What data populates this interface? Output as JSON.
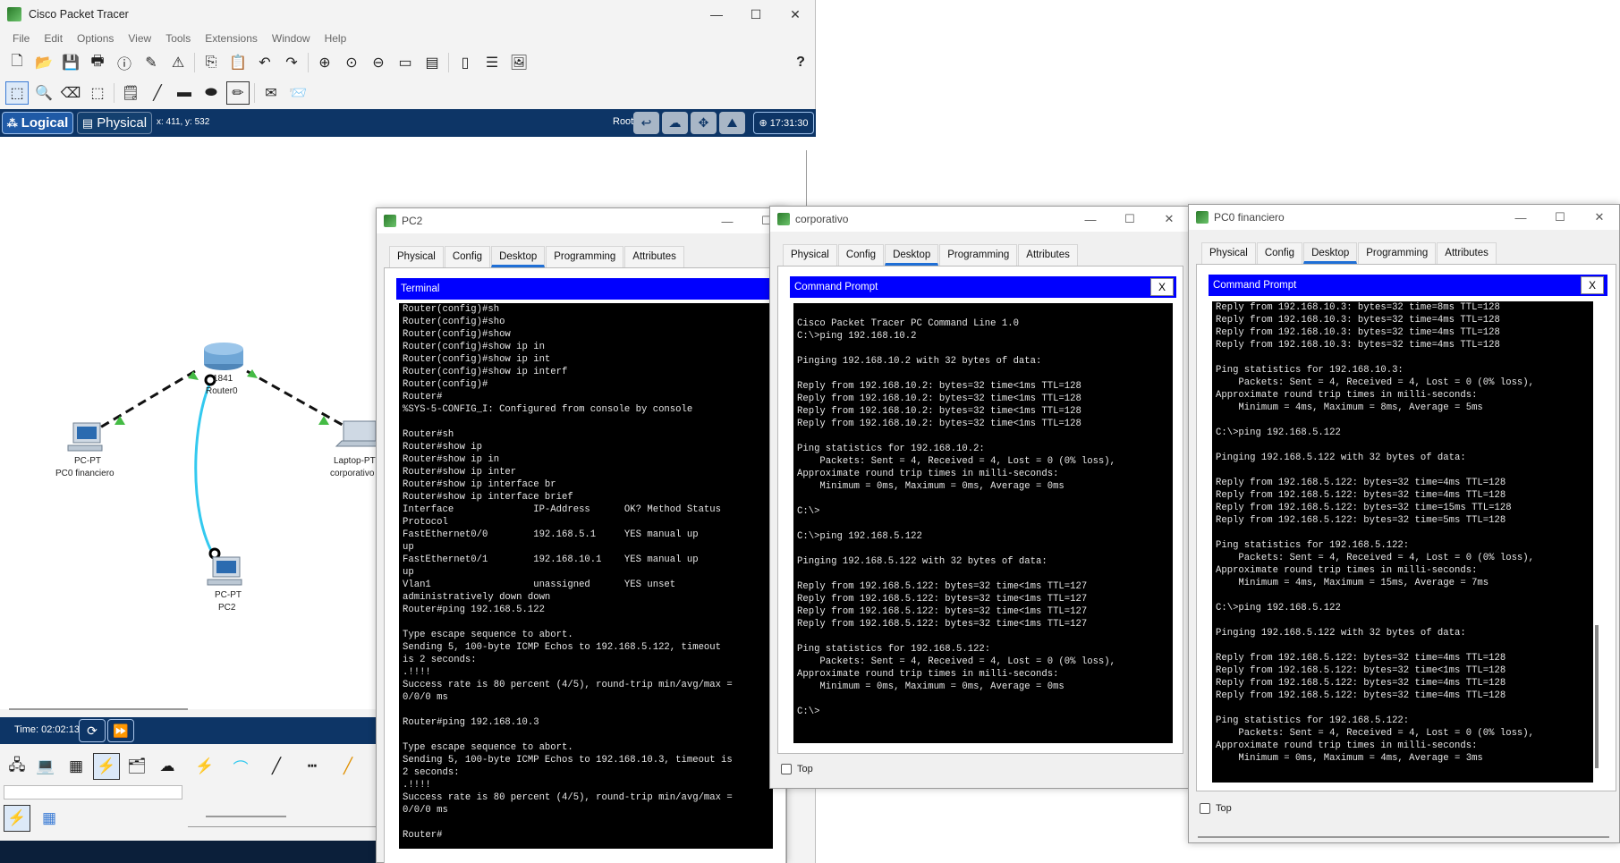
{
  "main": {
    "title": "Cisco Packet Tracer",
    "menu": [
      "File",
      "Edit",
      "Options",
      "View",
      "Tools",
      "Extensions",
      "Window",
      "Help"
    ],
    "toolbar_help": "?",
    "mode_logical": "Logical",
    "mode_physical": "Physical",
    "coords": "x: 411, y: 532",
    "root": "Root",
    "clock": "17:31:30",
    "time": "Time: 02:02:13"
  },
  "topology": {
    "router": {
      "model": "1841",
      "name": "Router0"
    },
    "pc0": {
      "type": "PC-PT",
      "name": "PC0 financiero"
    },
    "pc2": {
      "type": "PC-PT",
      "name": "PC2"
    },
    "laptop": {
      "type": "Laptop-PT",
      "name": "corporativo"
    }
  },
  "pc2_window": {
    "title": "PC2",
    "tabs": [
      "Physical",
      "Config",
      "Desktop",
      "Programming",
      "Attributes"
    ],
    "active_tab": "Desktop",
    "panel_title": "Terminal",
    "lines": [
      "Router(config)#sh",
      "Router(config)#sho",
      "Router(config)#show",
      "Router(config)#show ip in",
      "Router(config)#show ip int",
      "Router(config)#show ip interf",
      "Router(config)#",
      "Router#",
      "%SYS-5-CONFIG_I: Configured from console by console",
      "",
      "Router#sh",
      "Router#show ip",
      "Router#show ip in",
      "Router#show ip inter",
      "Router#show ip interface br",
      "Router#show ip interface brief",
      "Interface              IP-Address      OK? Method Status",
      "Protocol",
      "FastEthernet0/0        192.168.5.1     YES manual up",
      "up",
      "FastEthernet0/1        192.168.10.1    YES manual up",
      "up",
      "Vlan1                  unassigned      YES unset",
      "administratively down down",
      "Router#ping 192.168.5.122",
      "",
      "Type escape sequence to abort.",
      "Sending 5, 100-byte ICMP Echos to 192.168.5.122, timeout",
      "is 2 seconds:",
      ".!!!!",
      "Success rate is 80 percent (4/5), round-trip min/avg/max =",
      "0/0/0 ms",
      "",
      "Router#ping 192.168.10.3",
      "",
      "Type escape sequence to abort.",
      "Sending 5, 100-byte ICMP Echos to 192.168.10.3, timeout is",
      "2 seconds:",
      ".!!!!",
      "Success rate is 80 percent (4/5), round-trip min/avg/max =",
      "0/0/0 ms",
      "",
      "Router#"
    ]
  },
  "corp_window": {
    "title": "corporativo",
    "tabs": [
      "Physical",
      "Config",
      "Desktop",
      "Programming",
      "Attributes"
    ],
    "active_tab": "Desktop",
    "panel_title": "Command Prompt",
    "close_label": "X",
    "top_label": "Top",
    "lines": [
      "",
      "Cisco Packet Tracer PC Command Line 1.0",
      "C:\\>ping 192.168.10.2",
      "",
      "Pinging 192.168.10.2 with 32 bytes of data:",
      "",
      "Reply from 192.168.10.2: bytes=32 time<1ms TTL=128",
      "Reply from 192.168.10.2: bytes=32 time<1ms TTL=128",
      "Reply from 192.168.10.2: bytes=32 time<1ms TTL=128",
      "Reply from 192.168.10.2: bytes=32 time<1ms TTL=128",
      "",
      "Ping statistics for 192.168.10.2:",
      "    Packets: Sent = 4, Received = 4, Lost = 0 (0% loss),",
      "Approximate round trip times in milli-seconds:",
      "    Minimum = 0ms, Maximum = 0ms, Average = 0ms",
      "",
      "C:\\>",
      "",
      "C:\\>ping 192.168.5.122",
      "",
      "Pinging 192.168.5.122 with 32 bytes of data:",
      "",
      "Reply from 192.168.5.122: bytes=32 time<1ms TTL=127",
      "Reply from 192.168.5.122: bytes=32 time<1ms TTL=127",
      "Reply from 192.168.5.122: bytes=32 time<1ms TTL=127",
      "Reply from 192.168.5.122: bytes=32 time<1ms TTL=127",
      "",
      "Ping statistics for 192.168.5.122:",
      "    Packets: Sent = 4, Received = 4, Lost = 0 (0% loss),",
      "Approximate round trip times in milli-seconds:",
      "    Minimum = 0ms, Maximum = 0ms, Average = 0ms",
      "",
      "C:\\>"
    ]
  },
  "fin_window": {
    "title": "PC0 financiero",
    "tabs": [
      "Physical",
      "Config",
      "Desktop",
      "Programming",
      "Attributes"
    ],
    "active_tab": "Desktop",
    "panel_title": "Command Prompt",
    "close_label": "X",
    "top_label": "Top",
    "lines": [
      "Reply from 192.168.10.3: bytes=32 time=8ms TTL=128",
      "Reply from 192.168.10.3: bytes=32 time=4ms TTL=128",
      "Reply from 192.168.10.3: bytes=32 time=4ms TTL=128",
      "Reply from 192.168.10.3: bytes=32 time=4ms TTL=128",
      "",
      "Ping statistics for 192.168.10.3:",
      "    Packets: Sent = 4, Received = 4, Lost = 0 (0% loss),",
      "Approximate round trip times in milli-seconds:",
      "    Minimum = 4ms, Maximum = 8ms, Average = 5ms",
      "",
      "C:\\>ping 192.168.5.122",
      "",
      "Pinging 192.168.5.122 with 32 bytes of data:",
      "",
      "Reply from 192.168.5.122: bytes=32 time=4ms TTL=128",
      "Reply from 192.168.5.122: bytes=32 time=4ms TTL=128",
      "Reply from 192.168.5.122: bytes=32 time=15ms TTL=128",
      "Reply from 192.168.5.122: bytes=32 time=5ms TTL=128",
      "",
      "Ping statistics for 192.168.5.122:",
      "    Packets: Sent = 4, Received = 4, Lost = 0 (0% loss),",
      "Approximate round trip times in milli-seconds:",
      "    Minimum = 4ms, Maximum = 15ms, Average = 7ms",
      "",
      "C:\\>ping 192.168.5.122",
      "",
      "Pinging 192.168.5.122 with 32 bytes of data:",
      "",
      "Reply from 192.168.5.122: bytes=32 time=4ms TTL=128",
      "Reply from 192.168.5.122: bytes=32 time<1ms TTL=128",
      "Reply from 192.168.5.122: bytes=32 time=4ms TTL=128",
      "Reply from 192.168.5.122: bytes=32 time=4ms TTL=128",
      "",
      "Ping statistics for 192.168.5.122:",
      "    Packets: Sent = 4, Received = 4, Lost = 0 (0% loss),",
      "Approximate round trip times in milli-seconds:",
      "    Minimum = 0ms, Maximum = 4ms, Average = 3ms"
    ]
  }
}
